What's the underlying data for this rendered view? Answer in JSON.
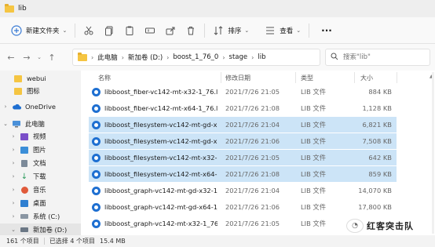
{
  "window": {
    "title": "lib"
  },
  "toolbar": {
    "new_label": "新建文件夹",
    "sort_label": "排序",
    "view_label": "查看",
    "more_label": "···"
  },
  "address": {
    "crumbs": [
      "此电脑",
      "新加卷 (D:)",
      "boost_1_76_0",
      "stage",
      "lib"
    ]
  },
  "search": {
    "placeholder": "搜索\"lib\""
  },
  "sidebar": {
    "items": [
      {
        "label": "webui",
        "icon": "folder-icon"
      },
      {
        "label": "图标",
        "icon": "folder-icon"
      },
      {
        "label": "OneDrive",
        "icon": "cloud-icon"
      },
      {
        "label": "此电脑",
        "icon": "monitor-icon"
      },
      {
        "label": "视频",
        "icon": "video-icon"
      },
      {
        "label": "图片",
        "icon": "picture-icon"
      },
      {
        "label": "文档",
        "icon": "document-icon"
      },
      {
        "label": "下载",
        "icon": "download-icon"
      },
      {
        "label": "音乐",
        "icon": "music-icon"
      },
      {
        "label": "桌面",
        "icon": "desktop-icon"
      },
      {
        "label": "系统 (C:)",
        "icon": "drive-icon"
      },
      {
        "label": "新加卷 (D:)",
        "icon": "drive-icon"
      }
    ]
  },
  "columns": {
    "name": "名称",
    "date": "修改日期",
    "type": "类型",
    "size": "大小"
  },
  "files": [
    {
      "name": "libboost_fiber-vc142-mt-x32-1_76.lib",
      "date": "2021/7/26 21:05",
      "type": "LIB 文件",
      "size": "884 KB",
      "selected": false
    },
    {
      "name": "libboost_fiber-vc142-mt-x64-1_76.lib",
      "date": "2021/7/26 21:08",
      "type": "LIB 文件",
      "size": "1,128 KB",
      "selected": false
    },
    {
      "name": "libboost_filesystem-vc142-mt-gd-x3...",
      "date": "2021/7/26 21:04",
      "type": "LIB 文件",
      "size": "6,821 KB",
      "selected": true
    },
    {
      "name": "libboost_filesystem-vc142-mt-gd-x6...",
      "date": "2021/7/26 21:06",
      "type": "LIB 文件",
      "size": "7,508 KB",
      "selected": true
    },
    {
      "name": "libboost_filesystem-vc142-mt-x32-1_...",
      "date": "2021/7/26 21:05",
      "type": "LIB 文件",
      "size": "642 KB",
      "selected": true
    },
    {
      "name": "libboost_filesystem-vc142-mt-x64-1_...",
      "date": "2021/7/26 21:08",
      "type": "LIB 文件",
      "size": "859 KB",
      "selected": true
    },
    {
      "name": "libboost_graph-vc142-mt-gd-x32-1_...",
      "date": "2021/7/26 21:04",
      "type": "LIB 文件",
      "size": "14,070 KB",
      "selected": false
    },
    {
      "name": "libboost_graph-vc142-mt-gd-x64-1_...",
      "date": "2021/7/26 21:06",
      "type": "LIB 文件",
      "size": "17,800 KB",
      "selected": false
    },
    {
      "name": "libboost_graph-vc142-mt-x32-1_76.lib",
      "date": "2021/7/26 21:05",
      "type": "LIB 文件",
      "size": "",
      "selected": false
    }
  ],
  "status": {
    "count": "161 个项目",
    "selected": "已选择 4 个项目",
    "size": "15.4 MB"
  },
  "watermark": {
    "text": "红客突击队"
  },
  "colors": {
    "selection": "#cce4f7",
    "accent": "#1e6fd1",
    "folder": "#f5c542"
  }
}
